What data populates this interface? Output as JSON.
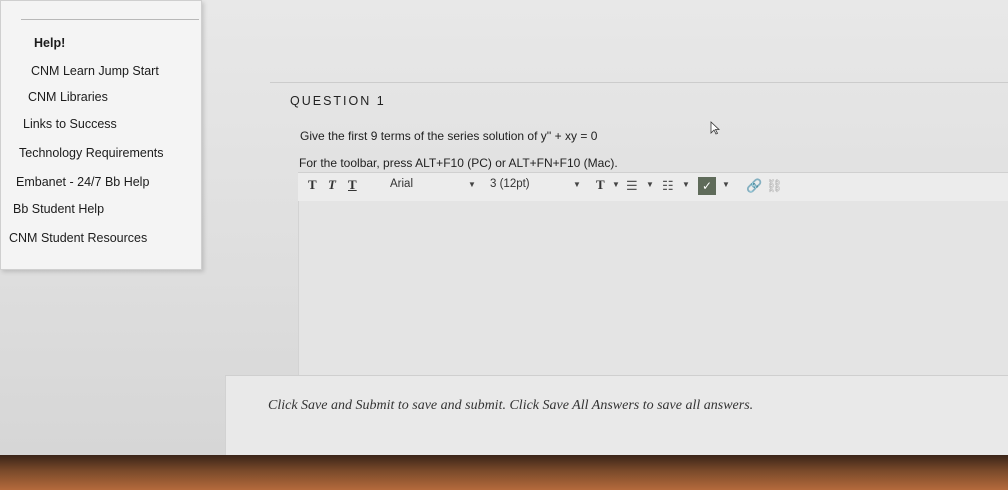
{
  "menu": {
    "help_heading": "Help!",
    "items": [
      {
        "label": "CNM Learn Jump Start"
      },
      {
        "label": "CNM Libraries"
      },
      {
        "label": "Links to Success"
      },
      {
        "label": "Technology Requirements"
      },
      {
        "label": "Embanet - 24/7 Bb Help"
      },
      {
        "label": "Bb Student Help"
      },
      {
        "label": "CNM Student Resources"
      }
    ]
  },
  "question": {
    "title": "QUESTION 1",
    "text": "Give the first 9 terms of the series solution of y'' + xy = 0",
    "toolbar_hint": "For the toolbar, press ALT+F10 (PC) or ALT+FN+F10 (Mac)."
  },
  "toolbar": {
    "format_buttons": [
      "T",
      "T",
      "T"
    ],
    "font_family": "Arial",
    "font_size": "3 (12pt)",
    "text_color_label": "T",
    "spellcheck_icon": "spellcheck-icon",
    "link_icon": "link-icon",
    "unlink_icon": "unlink-icon"
  },
  "footer": {
    "instruction": "Click Save and Submit to save and submit. Click Save All Answers to save all answers."
  }
}
